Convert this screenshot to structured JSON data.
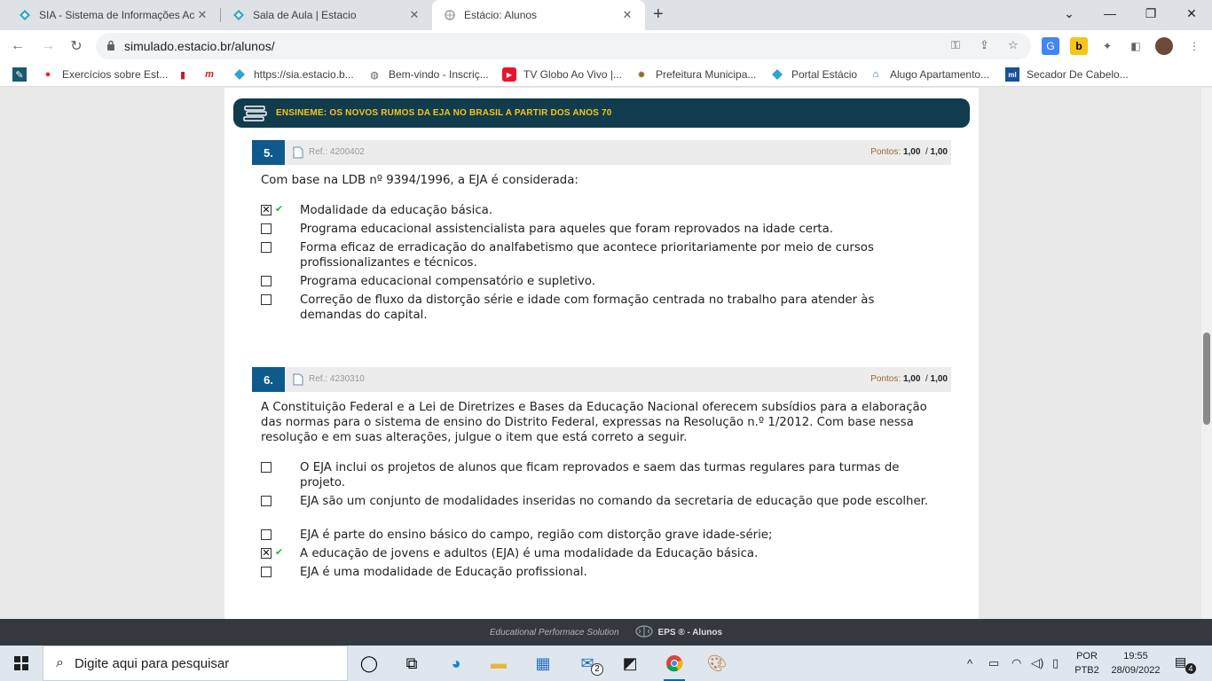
{
  "browser": {
    "tabs": [
      {
        "title": "SIA - Sistema de Informações Ac",
        "active": false
      },
      {
        "title": "Sala de Aula | Estacio",
        "active": false
      },
      {
        "title": "Estácio: Alunos",
        "active": true
      }
    ],
    "new_tab": "+",
    "url": "simulado.estacio.br/alunos/",
    "bookmarks": [
      {
        "label": "Exercícios sobre Est...",
        "icon": "tomato-icon"
      },
      {
        "label": "",
        "icon": "bookmark-small-icon"
      },
      {
        "label": "",
        "icon": "m-logo-icon"
      },
      {
        "label": "https://sia.estacio.b...",
        "icon": "estacio-diamond-icon"
      },
      {
        "label": "Bem-vindo - Inscriç...",
        "icon": "globe-icon"
      },
      {
        "label": "TV Globo Ao Vivo |...",
        "icon": "globoplay-icon"
      },
      {
        "label": "Prefeitura Municipa...",
        "icon": "crest-icon"
      },
      {
        "label": "Portal Estácio",
        "icon": "estacio-diamond-icon"
      },
      {
        "label": "Alugo Apartamento...",
        "icon": "house-icon"
      },
      {
        "label": "Secador De Cabelo...",
        "icon": "ml-icon"
      }
    ]
  },
  "page": {
    "banner": {
      "text": "ENSINEME: OS NOVOS RUMOS DA EJA NO BRASIL A PARTIR DOS ANOS 70",
      "icon": "books-icon"
    },
    "questions": [
      {
        "number": "5.",
        "ref": "Ref.: 4200402",
        "points_label": "Pontos:",
        "points": "1,00",
        "points_sep": "/",
        "points_max": "1,00",
        "statement": "Com base na LDB nº 9394/1996, a EJA é considerada:",
        "options": [
          {
            "text": "Modalidade da educação básica.",
            "checked": true,
            "correct": true
          },
          {
            "text": "Programa educacional assistencialista para aqueles que foram reprovados na idade certa.",
            "checked": false
          },
          {
            "text": "Forma eficaz de erradicação do analfabetismo que acontece prioritariamente por meio de cursos profissionalizantes e técnicos.",
            "checked": false
          },
          {
            "text": "Programa educacional compensatório e supletivo.",
            "checked": false
          },
          {
            "text": "Correção de fluxo da distorção série e idade com formação centrada no trabalho para atender às demandas do capital.",
            "checked": false
          }
        ]
      },
      {
        "number": "6.",
        "ref": "Ref.: 4230310",
        "points_label": "Pontos:",
        "points": "1,00",
        "points_sep": "/",
        "points_max": "1,00",
        "statement": "A Constituição Federal e a Lei de Diretrizes e Bases da Educação Nacional oferecem subsídios para a elaboração das normas para o sistema de ensino do Distrito Federal, expressas na Resolução n.º 1/2012. Com base nessa resolução e em suas alterações, julgue o item que está correto a seguir.",
        "options": [
          {
            "text": "O EJA inclui os projetos de alunos que ficam reprovados e saem das turmas regulares para turmas de projeto.",
            "checked": false
          },
          {
            "text": "EJA são um conjunto de modalidades inseridas no comando da secretaria de educação que pode escolher.",
            "checked": false
          },
          {
            "text": "EJA é parte do ensino básico do campo, região com distorção grave idade-série;",
            "checked": false
          },
          {
            "text": "A educação de jovens e adultos (EJA) é uma modalidade da Educação básica.",
            "checked": true,
            "correct": true
          },
          {
            "text": "EJA é uma modalidade de Educação profissional.",
            "checked": false
          }
        ]
      }
    ],
    "footer": {
      "left": "Educational Performace Solution",
      "right": "EPS ® - Alunos"
    }
  },
  "taskbar": {
    "search_placeholder": "Digite aqui para pesquisar",
    "mail_badge": "2",
    "lang_line1": "POR",
    "lang_line2": "PTB2",
    "time": "19:55",
    "date": "28/09/2022",
    "notifications": "4"
  },
  "colors": {
    "banner_bg": "#103c4e",
    "banner_text": "#f5c518",
    "question_number_bg": "#0f5a8c",
    "correct_tick": "#3aa935",
    "footer_bg": "#34393f"
  }
}
